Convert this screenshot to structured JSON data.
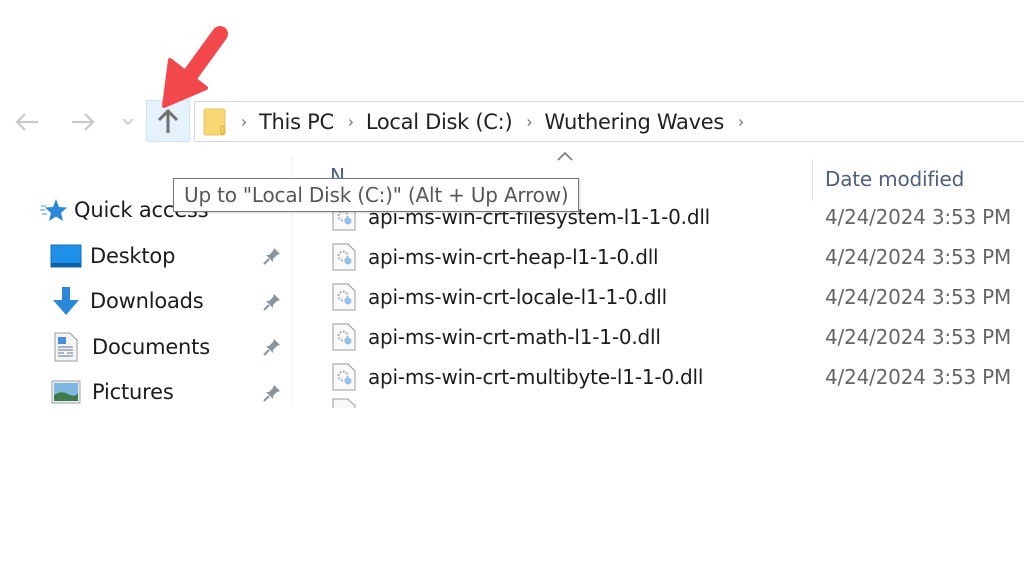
{
  "toolbar": {
    "back_icon": "arrow-left-icon",
    "forward_icon": "arrow-right-icon",
    "recent_icon": "chevron-down-icon",
    "up_icon": "arrow-up-icon"
  },
  "address_bar": {
    "folder_icon": "folder-icon",
    "breadcrumbs": [
      "This PC",
      "Local Disk (C:)",
      "Wuthering Waves"
    ],
    "separator": "›"
  },
  "tooltip": {
    "text": "Up to \"Local Disk (C:)\" (Alt + Up Arrow)"
  },
  "sidebar": {
    "items": [
      {
        "label": "Quick access",
        "icon": "quick-access-star-icon",
        "pinned": false
      },
      {
        "label": "Desktop",
        "icon": "desktop-icon",
        "pinned": true
      },
      {
        "label": "Downloads",
        "icon": "downloads-icon",
        "pinned": true
      },
      {
        "label": "Documents",
        "icon": "documents-icon",
        "pinned": true
      },
      {
        "label": "Pictures",
        "icon": "pictures-icon",
        "pinned": true
      }
    ]
  },
  "file_list": {
    "columns": {
      "name": "N",
      "date_modified": "Date modified"
    },
    "rows": [
      {
        "name": "api-ms-win-crt-filesystem-l1-1-0.dll",
        "date": "4/24/2024 3:53 PM"
      },
      {
        "name": "api-ms-win-crt-heap-l1-1-0.dll",
        "date": "4/24/2024 3:53 PM"
      },
      {
        "name": "api-ms-win-crt-locale-l1-1-0.dll",
        "date": "4/24/2024 3:53 PM"
      },
      {
        "name": "api-ms-win-crt-math-l1-1-0.dll",
        "date": "4/24/2024 3:53 PM"
      },
      {
        "name": "api-ms-win-crt-multibyte-l1-1-0.dll",
        "date": "4/24/2024 3:53 PM"
      }
    ]
  },
  "colors": {
    "annotation_arrow": "#f2474b",
    "up_button_highlight": "#e5f1fb",
    "header_text": "#4c607a",
    "folder_yellow": "#f8d775"
  }
}
